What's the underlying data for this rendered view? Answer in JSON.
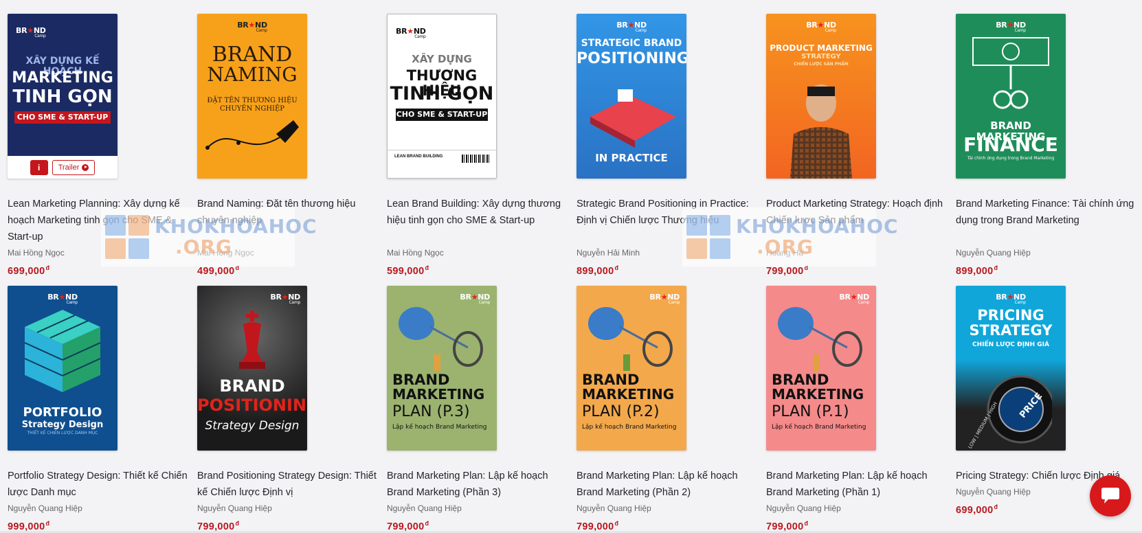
{
  "products": [
    {
      "title": "Lean Marketing Planning: Xây dựng kế hoạch Marketing tinh gọn cho SME & Start-up",
      "author": "Mai Hồng Ngọc",
      "price": "699,000",
      "currency": "đ",
      "cover": {
        "logo": "BR★ND",
        "logo_sub": "Camp",
        "lines": [
          "XÂY DỰNG KẾ HOẠCH",
          "MARKETING",
          "TINH GỌN",
          "CHO SME & START-UP"
        ],
        "bg": "#1b2a62"
      }
    },
    {
      "title": "Brand Naming: Đặt tên thương hiệu chuyên nghiệp",
      "author": "Mai Hồng Ngọc",
      "price": "499,000",
      "currency": "đ",
      "cover": {
        "logo": "BR★ND",
        "logo_sub": "Camp",
        "lines": [
          "BRAND",
          "NAMING",
          "ĐẶT TÊN THƯƠNG HIỆU",
          "CHUYÊN NGHIỆP"
        ],
        "bg": "#f7a11a"
      }
    },
    {
      "title": "Lean Brand Building: Xây dựng thương hiệu tinh gọn cho SME & Start-up",
      "author": "Mai Hồng Ngọc",
      "price": "599,000",
      "currency": "đ",
      "cover": {
        "logo": "BR★ND",
        "logo_sub": "Camp",
        "lines": [
          "XÂY DỰNG",
          "THƯƠNG HIỆU",
          "TINH GỌN",
          "CHO SME & START-UP",
          "LEAN BRAND BUILDING"
        ],
        "bg": "#ffffff"
      }
    },
    {
      "title": "Strategic Brand Positioning in Practice: Định vị Chiến lược Thương hiệu",
      "author": "Nguyễn Hải Minh",
      "price": "899,000",
      "currency": "đ",
      "cover": {
        "logo": "BR★ND",
        "logo_sub": "Camp",
        "lines": [
          "STRATEGIC BRAND",
          "POSITIONING",
          "IN PRACTICE"
        ],
        "bg": "#2f86d8"
      }
    },
    {
      "title": "Product Marketing Strategy: Hoạch định Chiến lược Sản phẩm",
      "author": "Hoàng Hà",
      "price": "799,000",
      "currency": "đ",
      "cover": {
        "logo": "BR★ND",
        "logo_sub": "Camp",
        "lines": [
          "PRODUCT MARKETING",
          "STRATEGY",
          "CHIẾN LƯỢC SẢN PHẨM"
        ],
        "bg": "#f58220"
      }
    },
    {
      "title": "Brand Marketing Finance: Tài chính ứng dụng trong Brand Marketing",
      "author": "Nguyễn Quang Hiệp",
      "price": "899,000",
      "currency": "đ",
      "cover": {
        "logo": "BR★ND",
        "logo_sub": "Camp",
        "lines": [
          "BRAND MARKETING",
          "FINANCE",
          "Tài chính ứng dụng trong Brand Marketing"
        ],
        "bg": "#1f8d5a"
      }
    },
    {
      "title": "Portfolio Strategy Design: Thiết kế Chiến lược Danh mục",
      "author": "Nguyễn Quang Hiệp",
      "price": "999,000",
      "currency": "đ",
      "cover": {
        "logo": "BR★ND",
        "logo_sub": "Camp",
        "lines": [
          "PORTFOLIO",
          "Strategy Design",
          "THIẾT KẾ CHIẾN LƯỢC DANH MỤC"
        ],
        "bg": "#0f4f8f"
      }
    },
    {
      "title": "Brand Positioning Strategy Design: Thiết kế Chiến lược Định vị",
      "author": "Nguyễn Quang Hiệp",
      "price": "799,000",
      "currency": "đ",
      "cover": {
        "logo": "BR★ND",
        "logo_sub": "Camp",
        "lines": [
          "BRAND",
          "POSITIONING",
          "Strategy Design"
        ],
        "bg": "#2b2b2b"
      }
    },
    {
      "title": "Brand Marketing Plan: Lập kế hoạch Brand Marketing (Phần 3)",
      "author": "Nguyễn Quang Hiệp",
      "price": "799,000",
      "currency": "đ",
      "cover": {
        "logo": "BR★ND",
        "logo_sub": "Camp",
        "lines": [
          "BRAND",
          "MARKETING",
          "PLAN (P.3)",
          "Lập kế hoạch Brand Marketing"
        ],
        "bg": "#9bb36f"
      }
    },
    {
      "title": "Brand Marketing Plan: Lập kế hoạch Brand Marketing (Phần 2)",
      "author": "Nguyễn Quang Hiệp",
      "price": "799,000",
      "currency": "đ",
      "cover": {
        "logo": "BR★ND",
        "logo_sub": "Camp",
        "lines": [
          "BRAND",
          "MARKETING",
          "PLAN (P.2)",
          "Lập kế hoạch Brand Marketing"
        ],
        "bg": "#f3a84c"
      }
    },
    {
      "title": "Brand Marketing Plan: Lập kế hoạch Brand Marketing (Phần 1)",
      "author": "Nguyễn Quang Hiệp",
      "price": "799,000",
      "currency": "đ",
      "cover": {
        "logo": "BR★ND",
        "logo_sub": "Camp",
        "lines": [
          "BRAND",
          "MARKETING",
          "PLAN (P.1)",
          "Lập kế hoạch Brand Marketing"
        ],
        "bg": "#f58a8a"
      }
    },
    {
      "title": "Pricing Strategy: Chiến lược Định giá",
      "author": "Nguyễn Quang Hiệp",
      "price": "699,000",
      "currency": "đ",
      "cover": {
        "logo": "BR★ND",
        "logo_sub": "Camp",
        "lines": [
          "PRICING",
          "STRATEGY",
          "CHIẾN LƯỢC ĐỊNH GIÁ",
          "PRICE",
          "LOW | MEDIUM | HIGH"
        ],
        "bg": "#0fa3d6"
      }
    }
  ],
  "card_actions": {
    "trailer_label": "Trailer",
    "info_symbol": "i"
  },
  "watermark": {
    "line1": "KHOKHOAHOC",
    "line2": ".ORG"
  },
  "chat_widget": {
    "icon": "chat-bubble-icon"
  }
}
